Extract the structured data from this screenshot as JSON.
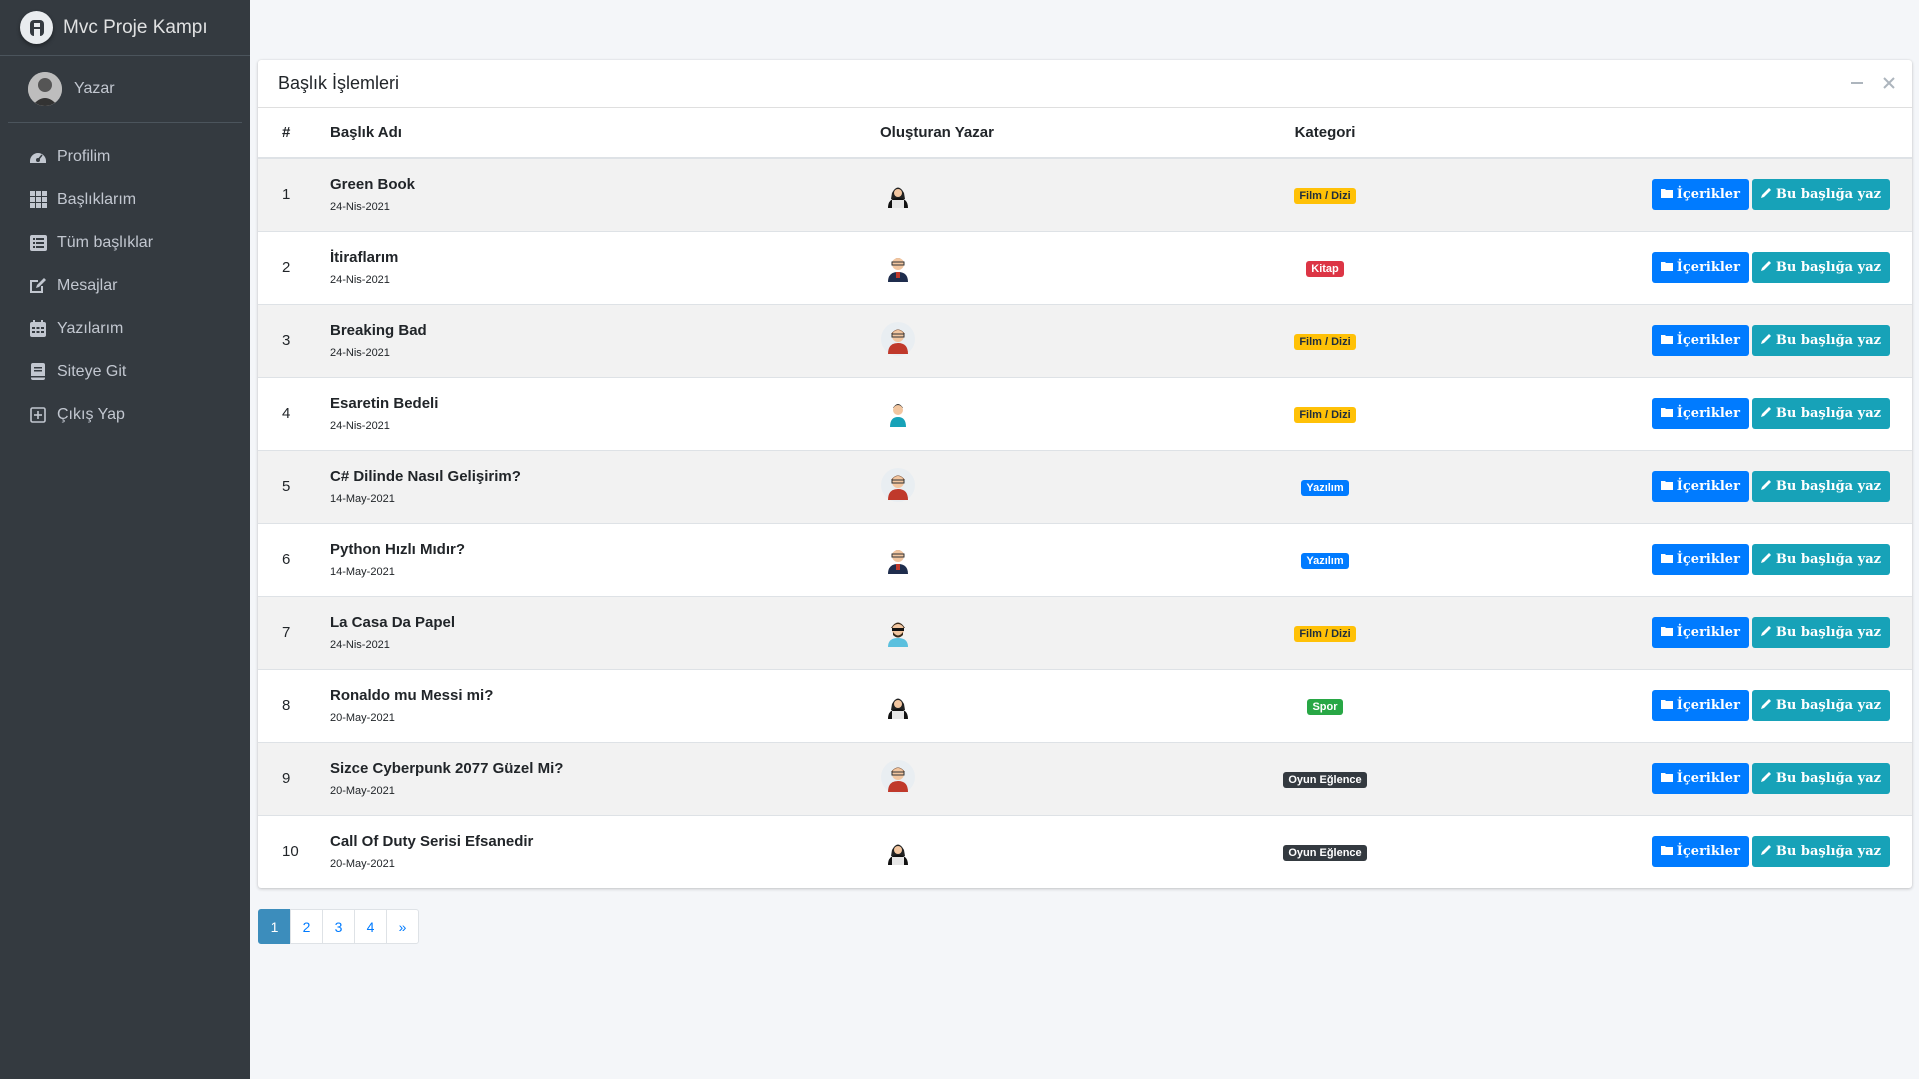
{
  "brand": {
    "name": "Mvc Proje Kampı"
  },
  "user": {
    "name": "Yazar"
  },
  "nav": [
    {
      "label": "Profilim",
      "icon": "dashboard-icon"
    },
    {
      "label": "Başlıklarım",
      "icon": "grid-icon"
    },
    {
      "label": "Tüm başlıklar",
      "icon": "list-icon"
    },
    {
      "label": "Mesajlar",
      "icon": "edit-icon"
    },
    {
      "label": "Yazılarım",
      "icon": "calendar-icon"
    },
    {
      "label": "Siteye Git",
      "icon": "book-icon"
    },
    {
      "label": "Çıkış Yap",
      "icon": "plus-square-icon"
    }
  ],
  "card": {
    "title": "Başlık İşlemleri",
    "headers": {
      "num": "#",
      "title": "Başlık Adı",
      "author": "Oluşturan Yazar",
      "category": "Kategori"
    }
  },
  "actions": {
    "contents": "İçerikler",
    "write": "Bu başlığa yaz"
  },
  "colors": {
    "film": "#ffc107",
    "kitap": "#dc3545",
    "yazilim": "#007bff",
    "spor": "#28a745",
    "oyun": "#343a40"
  },
  "rows": [
    {
      "num": "1",
      "title": "Green Book",
      "date": "24-Nis-2021",
      "avatar": "hacker",
      "category": "Film / Dizi",
      "cat": "film"
    },
    {
      "num": "2",
      "title": "İtiraflarım",
      "date": "24-Nis-2021",
      "avatar": "man-glasses",
      "category": "Kitap",
      "cat": "kitap"
    },
    {
      "num": "3",
      "title": "Breaking Bad",
      "date": "24-Nis-2021",
      "avatar": "man-red",
      "category": "Film / Dizi",
      "cat": "film"
    },
    {
      "num": "4",
      "title": "Esaretin Bedeli",
      "date": "24-Nis-2021",
      "avatar": "man-teal",
      "category": "Film / Dizi",
      "cat": "film"
    },
    {
      "num": "5",
      "title": "C# Dilinde Nasıl Gelişirim?",
      "date": "14-May-2021",
      "avatar": "man-red",
      "category": "Yazılım",
      "cat": "yazilim"
    },
    {
      "num": "6",
      "title": "Python Hızlı Mıdır?",
      "date": "14-May-2021",
      "avatar": "man-glasses",
      "category": "Yazılım",
      "cat": "yazilim"
    },
    {
      "num": "7",
      "title": "La Casa Da Papel",
      "date": "24-Nis-2021",
      "avatar": "man-sunglasses",
      "category": "Film / Dizi",
      "cat": "film"
    },
    {
      "num": "8",
      "title": "Ronaldo mu Messi mi?",
      "date": "20-May-2021",
      "avatar": "hacker",
      "category": "Spor",
      "cat": "spor"
    },
    {
      "num": "9",
      "title": "Sizce Cyberpunk 2077 Güzel Mi?",
      "date": "20-May-2021",
      "avatar": "man-red",
      "category": "Oyun Eğlence",
      "cat": "oyun"
    },
    {
      "num": "10",
      "title": "Call Of Duty Serisi Efsanedir",
      "date": "20-May-2021",
      "avatar": "hacker",
      "category": "Oyun Eğlence",
      "cat": "oyun"
    }
  ],
  "pagination": {
    "pages": [
      "1",
      "2",
      "3",
      "4"
    ],
    "next": "»",
    "active": "1"
  }
}
